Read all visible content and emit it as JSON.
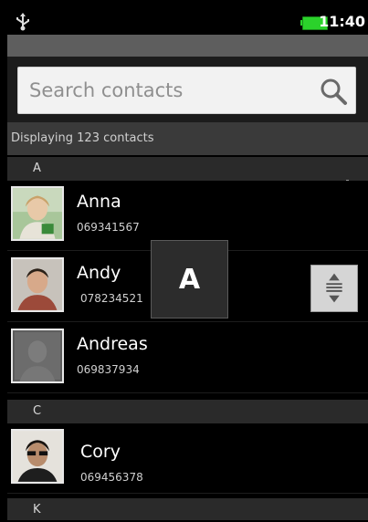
{
  "status_bar": {
    "time": "11:40",
    "usb_icon": "usb-icon",
    "battery_icon": "battery-icon",
    "battery_color": "#2bd22b"
  },
  "search": {
    "placeholder": "Search contacts",
    "icon": "search-icon"
  },
  "contact_count": "Displaying 123 contacts",
  "sections": [
    {
      "letter": "A",
      "contacts": [
        {
          "name": "Anna",
          "phone": "069341567"
        },
        {
          "name": "Andy",
          "phone": "078234521"
        },
        {
          "name": "Andreas",
          "phone": "069837934"
        }
      ]
    },
    {
      "letter": "C",
      "contacts": [
        {
          "name": "Cory",
          "phone": "069456378"
        }
      ]
    },
    {
      "letter": "K",
      "contacts": []
    }
  ],
  "fast_scroll": {
    "letter": "A",
    "handle_icon": "fast-scroll-handle-icon"
  }
}
